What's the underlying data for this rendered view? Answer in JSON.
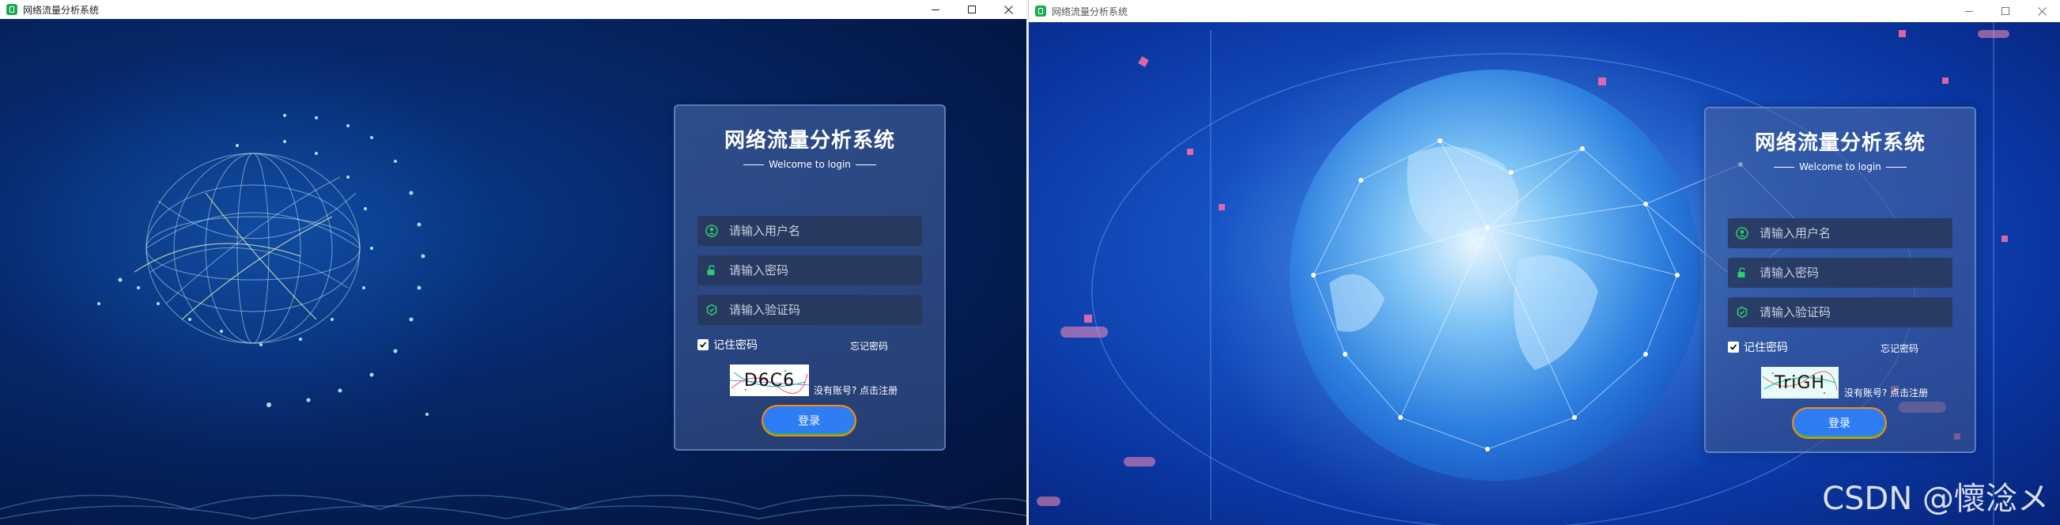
{
  "windows": [
    {
      "title": "网络流量分析系统",
      "login": {
        "title": "网络流量分析系统",
        "subtitle": "Welcome to login",
        "username_placeholder": "请输入用户名",
        "password_placeholder": "请输入密码",
        "captcha_placeholder": "请输入验证码",
        "remember_label": "记住密码",
        "remember_checked": true,
        "forgot_label": "忘记密码",
        "captcha_text": "D6C6",
        "register_label": "没有账号? 点击注册",
        "login_button": "登录"
      }
    },
    {
      "title": "网络流量分析系统",
      "login": {
        "title": "网络流量分析系统",
        "subtitle": "Welcome to login",
        "username_placeholder": "请输入用户名",
        "password_placeholder": "请输入密码",
        "captcha_placeholder": "请输入验证码",
        "remember_label": "记住密码",
        "remember_checked": true,
        "forgot_label": "忘记密码",
        "captcha_text": "TriGH",
        "register_label": "没有账号? 点击注册",
        "login_button": "登录"
      },
      "watermark": "CSDN @懷淰メ"
    }
  ],
  "colors": {
    "icon_green": "#2ecc71",
    "button_blue": "#2f7df4",
    "button_border": "#ff8a00"
  },
  "icons": [
    "app-icon",
    "minimize-icon",
    "maximize-icon",
    "close-icon",
    "user-icon",
    "lock-icon",
    "shield-icon",
    "checkbox-check-icon"
  ]
}
